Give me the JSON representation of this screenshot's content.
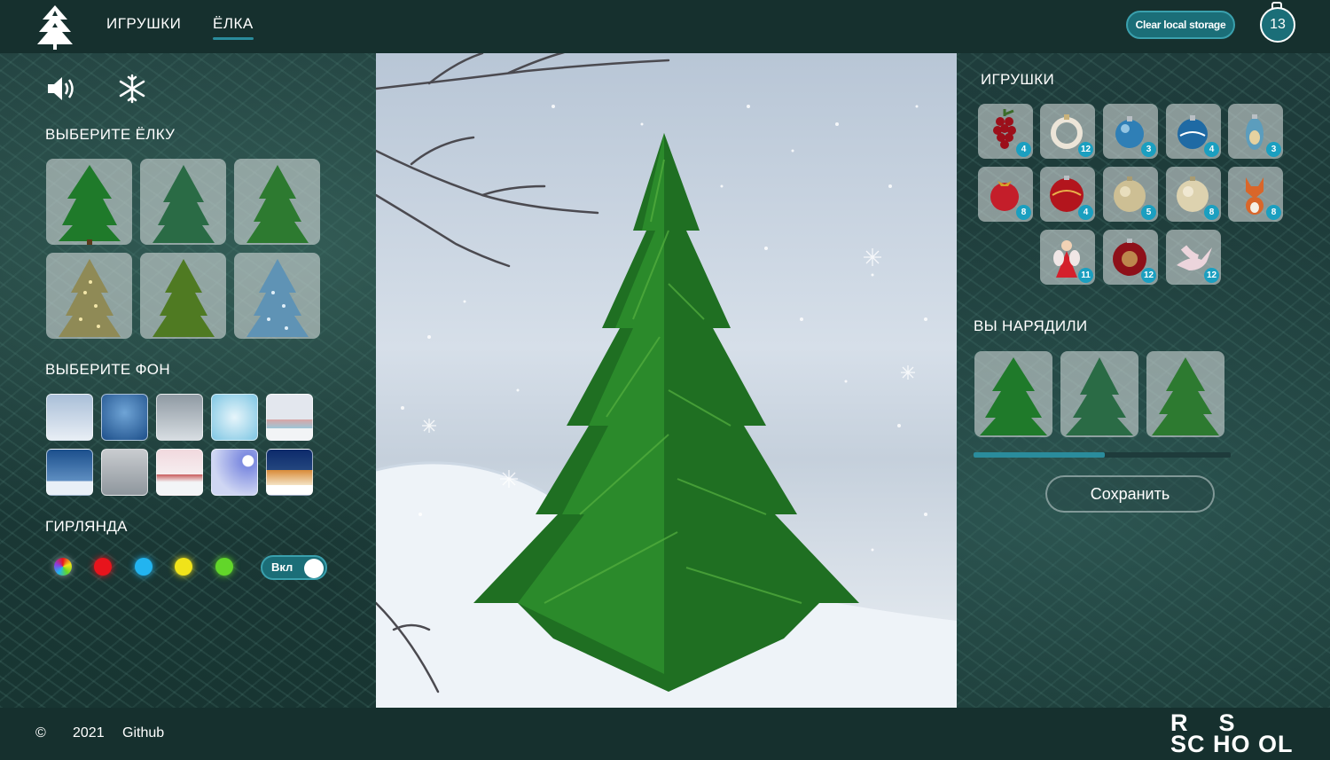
{
  "header": {
    "logo_icon": "christmas-tree-logo-icon",
    "nav": [
      {
        "label": "ИГРУШКИ",
        "active": false
      },
      {
        "label": "ЁЛКА",
        "active": true
      }
    ],
    "clear_label": "Clear local storage",
    "selected_count": "13"
  },
  "left": {
    "sound_icon": "speaker-icon",
    "snow_icon": "snowflake-icon",
    "tree_title": "ВЫБЕРИТЕ ЁЛКУ",
    "bg_title": "ВЫБЕРИТЕ ФОН",
    "garland_title": "ГИРЛЯНДА",
    "garland_colors": [
      "multicolor",
      "#e8141c",
      "#22b4f0",
      "#f0e31a",
      "#62d62a"
    ],
    "garland_toggle_label": "Вкл",
    "garland_on": true
  },
  "right": {
    "toys_title": "ИГРУШКИ",
    "toys": [
      {
        "name": "grapes",
        "count": "4"
      },
      {
        "name": "ring",
        "count": "12"
      },
      {
        "name": "blue-ball",
        "count": "3"
      },
      {
        "name": "blue-ball-2",
        "count": "4"
      },
      {
        "name": "icicle",
        "count": "3"
      },
      {
        "name": "red-ball-bow",
        "count": "8"
      },
      {
        "name": "red-ball",
        "count": "4"
      },
      {
        "name": "gold-ball",
        "count": "5"
      },
      {
        "name": "gold-ball-2",
        "count": "8"
      },
      {
        "name": "fox",
        "count": "8"
      },
      {
        "name": "angel",
        "count": "11"
      },
      {
        "name": "red-ornament",
        "count": "12"
      },
      {
        "name": "dove",
        "count": "12"
      }
    ],
    "dressed_title": "ВЫ НАРЯДИЛИ",
    "progress": 0.51,
    "save_label": "Сохранить"
  },
  "footer": {
    "copyright_icon": "©",
    "year": "2021",
    "github_label": "Github",
    "school_logo": "RS School JS"
  },
  "colors": {
    "header_bg": "#16302e",
    "accent": "#2a8c9c",
    "badge": "#1b9fc0"
  }
}
